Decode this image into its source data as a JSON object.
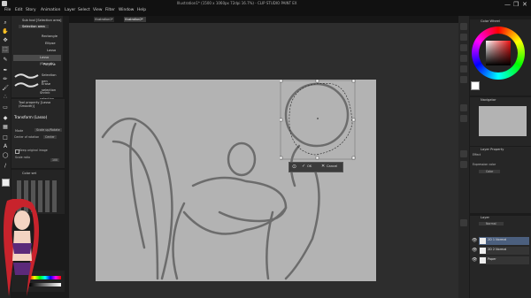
{
  "window": {
    "title": "Illustration1* (1500 x 1060px 72dpi 16.7%) - CLIP STUDIO PAINT EX",
    "minimize": "—",
    "restore": "❐",
    "close": "✕"
  },
  "menu": [
    "File",
    "Edit",
    "Story",
    "Animation",
    "Layer",
    "Select",
    "View",
    "Filter",
    "Window",
    "Help"
  ],
  "subtool": {
    "header": "Sub tool [Selection area]",
    "tab": "Selection area",
    "items": [
      "Rectangle",
      "Ellipse",
      "Lasso",
      "Lasso (Smooth)",
      "Polyline",
      "Selection pen",
      "Erase selection",
      "Shrink selection"
    ],
    "selected_index": 3
  },
  "toolprop": {
    "header": "Tool property [Lasso (Smooth)]",
    "title": "Transform (Lasso)",
    "mode_label": "Mode",
    "mode_value": "Scale up/Rotate",
    "center_label": "Center of rotation",
    "center_value": "Center",
    "keep_label": "Keep original image",
    "scale_label": "Scale ratio",
    "scale_value": "100"
  },
  "palette_header": "Color set",
  "canvas_tabs": [
    "Illustration1*",
    "Illustration2*"
  ],
  "transform_bar": {
    "ok": "OK",
    "cancel": "Cancel"
  },
  "right": {
    "color_wheel_title": "Color Wheel",
    "navigator_title": "Navigator",
    "layer_property_title": "Layer Property",
    "effect_label": "Effect",
    "expression_label": "Expression color",
    "expression_value": "Color",
    "layers_title": "Layer",
    "blend_value": "Normal",
    "layers": [
      "2D 1 Normal",
      "2D 2 Normal",
      "Paper"
    ],
    "selected_layer": 0
  },
  "colors": {
    "canvas": "#b3b3b3",
    "panel": "#262626",
    "selection_blue": "#4b5f7e",
    "accent": "#3a7bd5"
  }
}
